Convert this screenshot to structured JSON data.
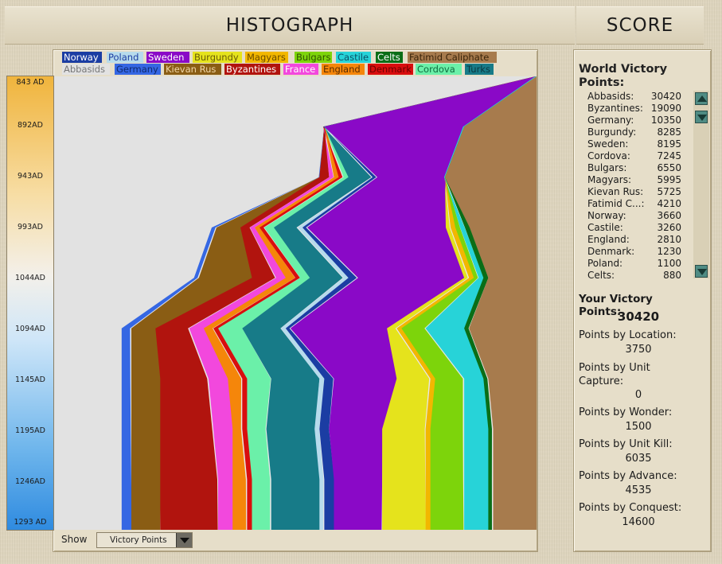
{
  "header": {
    "title": "HISTOGRAPH",
    "score_title": "SCORE"
  },
  "legend": [
    {
      "name": "Norway",
      "color": "#1b3da3",
      "text": "#ffffff"
    },
    {
      "name": "Poland",
      "color": "#b7dbec",
      "text": "#1b3da3"
    },
    {
      "name": "Sweden",
      "color": "#8a09c7",
      "text": "#ffffff"
    },
    {
      "name": "Burgundy",
      "color": "#e5e31c",
      "text": "#6a5d06"
    },
    {
      "name": "Magyars",
      "color": "#f2b700",
      "text": "#6a4a00"
    },
    {
      "name": "Bulgars",
      "color": "#7dd40b",
      "text": "#2e5200"
    },
    {
      "name": "Castile",
      "color": "#27d3d8",
      "text": "#0a4f66"
    },
    {
      "name": "Celts",
      "color": "#0a6e17",
      "text": "#ffffff"
    },
    {
      "name": "Fatimid Caliphate",
      "color": "#a77b4d",
      "text": "#3a240a"
    },
    {
      "name": "Abbasids",
      "color": "#e2e2e2",
      "text": "#777777"
    },
    {
      "name": "Germany",
      "color": "#3567e3",
      "text": "#0f2a6e"
    },
    {
      "name": "Kievan Rus",
      "color": "#8a5d14",
      "text": "#f2d8a8"
    },
    {
      "name": "Byzantines",
      "color": "#b1140e",
      "text": "#ffffff"
    },
    {
      "name": "France",
      "color": "#f248dd",
      "text": "#ffffff"
    },
    {
      "name": "England",
      "color": "#f5860a",
      "text": "#5a2b00"
    },
    {
      "name": "Denmark",
      "color": "#d90e0e",
      "text": "#6b0000"
    },
    {
      "name": "Cordova",
      "color": "#6bf0a9",
      "text": "#0f6b3e"
    },
    {
      "name": "Turks",
      "color": "#177b88",
      "text": "#0b3840"
    }
  ],
  "timeline": [
    "843 AD",
    "892AD",
    "943AD",
    "993AD",
    "1044AD",
    "1094AD",
    "1145AD",
    "1195AD",
    "1246AD",
    "1293 AD"
  ],
  "show": {
    "label": "Show",
    "value": "Victory Points"
  },
  "score_panel": {
    "title": "World Victory Points:",
    "rows": [
      {
        "name": "Abbasids:",
        "value": "30420"
      },
      {
        "name": "Byzantines:",
        "value": "19090"
      },
      {
        "name": "Germany:",
        "value": "10350"
      },
      {
        "name": "Burgundy:",
        "value": "8285"
      },
      {
        "name": "Sweden:",
        "value": "8195"
      },
      {
        "name": "Cordova:",
        "value": "7245"
      },
      {
        "name": "Bulgars:",
        "value": "6550"
      },
      {
        "name": "Magyars:",
        "value": "5995"
      },
      {
        "name": "Kievan Rus:",
        "value": "5725"
      },
      {
        "name": "Fatimid C...:",
        "value": "4210"
      },
      {
        "name": "Norway:",
        "value": "3660"
      },
      {
        "name": "Castile:",
        "value": "3260"
      },
      {
        "name": "England:",
        "value": "2810"
      },
      {
        "name": "Denmark:",
        "value": "1230"
      },
      {
        "name": "Poland:",
        "value": "1100"
      },
      {
        "name": "Celts:",
        "value": "880"
      }
    ],
    "your_label": "Your Victory Points:",
    "your_value": "30420",
    "stats": [
      {
        "label": "Points by Location:",
        "value": "3750"
      },
      {
        "label": "Points by Unit Capture:",
        "value": "0"
      },
      {
        "label": "Points by Wonder:",
        "value": "1500"
      },
      {
        "label": "Points by Unit Kill:",
        "value": "6035"
      },
      {
        "label": "Points by Advance:",
        "value": "4535"
      },
      {
        "label": "Points by Conquest:",
        "value": "14600"
      }
    ]
  },
  "chart_data": {
    "type": "area",
    "orientation": "vertical-time",
    "time_labels": [
      "843 AD",
      "892AD",
      "943AD",
      "993AD",
      "1044AD",
      "1094AD",
      "1145AD",
      "1195AD",
      "1246AD",
      "1293 AD"
    ],
    "series_order": [
      "Abbasids",
      "Germany",
      "Kievan Rus",
      "Byzantines",
      "France",
      "England",
      "Denmark",
      "Cordova",
      "Turks",
      "Poland",
      "Norway",
      "Sweden",
      "Burgundy",
      "Magyars",
      "Bulgars",
      "Castile",
      "Celts",
      "Fatimid Caliphate"
    ],
    "rows": [
      [
        100,
        0,
        0,
        0,
        0,
        0,
        0,
        0,
        0,
        0,
        0,
        0,
        0,
        0,
        0,
        0,
        0,
        0
      ],
      [
        56,
        0,
        0,
        0,
        0,
        0,
        0,
        0,
        0,
        0,
        0,
        29,
        0,
        0,
        0,
        0,
        0,
        15
      ],
      [
        55,
        0,
        0,
        2,
        1,
        1,
        1,
        1,
        5,
        0,
        1,
        14,
        0,
        0,
        0,
        0,
        0,
        19
      ],
      [
        33,
        1,
        5,
        2,
        1,
        1,
        1,
        2,
        5,
        1,
        1,
        29,
        1,
        1,
        1,
        1,
        1,
        14
      ],
      [
        29,
        1,
        11,
        5,
        2,
        2,
        1,
        2,
        7,
        1,
        2,
        22,
        1,
        1,
        1,
        1,
        1,
        10
      ],
      [
        14,
        2,
        5,
        7,
        3,
        2,
        1,
        5,
        8,
        1,
        1,
        20,
        2,
        1,
        5,
        8,
        1,
        14
      ],
      [
        14,
        2,
        6,
        10,
        4,
        3,
        1,
        5,
        10,
        1,
        2,
        13,
        7,
        1,
        6,
        4,
        1,
        10
      ],
      [
        14,
        2,
        6,
        11,
        4,
        2,
        1,
        4,
        10,
        1,
        2,
        11,
        9,
        1,
        7,
        5,
        1,
        9
      ],
      [
        14,
        2,
        6,
        12,
        3,
        3,
        1,
        4,
        10,
        1,
        2,
        10,
        9,
        1,
        7,
        5,
        1,
        9
      ],
      [
        14,
        2,
        6,
        12,
        3,
        3,
        1,
        4,
        10,
        1,
        2,
        10,
        9,
        1,
        7,
        5,
        1,
        9
      ]
    ]
  }
}
